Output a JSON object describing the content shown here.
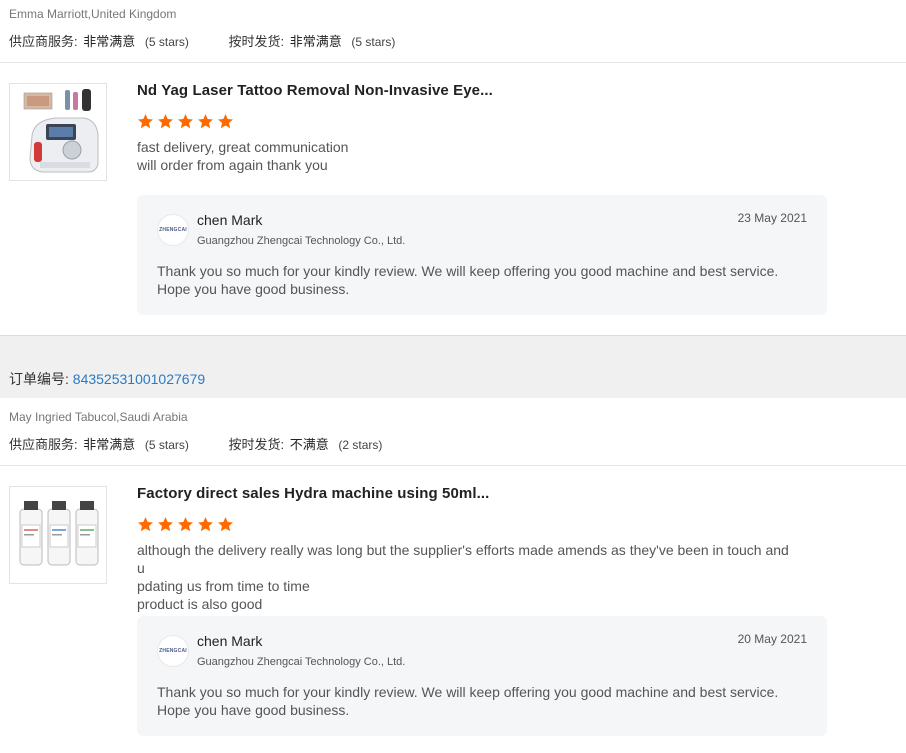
{
  "entries": [
    {
      "buyer": "Emma Marriott,United Kingdom",
      "ratings": [
        {
          "label": "供应商服务:",
          "value": "非常满意",
          "stars": "(5 stars)"
        },
        {
          "label": "按时发货:",
          "value": "非常满意",
          "stars": "(5 stars)"
        }
      ],
      "product": {
        "title": "Nd Yag Laser Tattoo Removal Non-Invasive Eye...",
        "rating": 5,
        "review": [
          "fast delivery, great communication",
          "will order from again thank you"
        ]
      },
      "reply": {
        "avatar_text": "ZHENGCAI",
        "name": "chen Mark",
        "company": "Guangzhou Zhengcai Technology Co., Ltd.",
        "date": "23 May 2021",
        "text": "Thank you so much for your kindly review. We will keep offering you good machine and best service. Hope you have good business."
      }
    },
    {
      "order_label": "订单编号:",
      "order_number": "84352531001027679",
      "buyer": "May Ingried Tabucol,Saudi Arabia",
      "ratings": [
        {
          "label": "供应商服务:",
          "value": "非常满意",
          "stars": "(5 stars)"
        },
        {
          "label": "按时发货:",
          "value": "不满意",
          "stars": "(2 stars)"
        }
      ],
      "product": {
        "title": "Factory direct sales Hydra machine using 50ml...",
        "rating": 5,
        "review": [
          "although the delivery really was long but the supplier's efforts made amends as they've been in touch and u",
          "pdating us from time to time",
          "product is also good"
        ]
      },
      "reply": {
        "avatar_text": "ZHENGCAI",
        "name": "chen Mark",
        "company": "Guangzhou Zhengcai Technology Co., Ltd.",
        "date": "20 May 2021",
        "text": "Thank you so much for your kindly review. We will keep offering you good machine and best service. Hope you have good business."
      }
    }
  ],
  "colors": {
    "star": "#ff6a00",
    "link": "#2a7ac4"
  }
}
